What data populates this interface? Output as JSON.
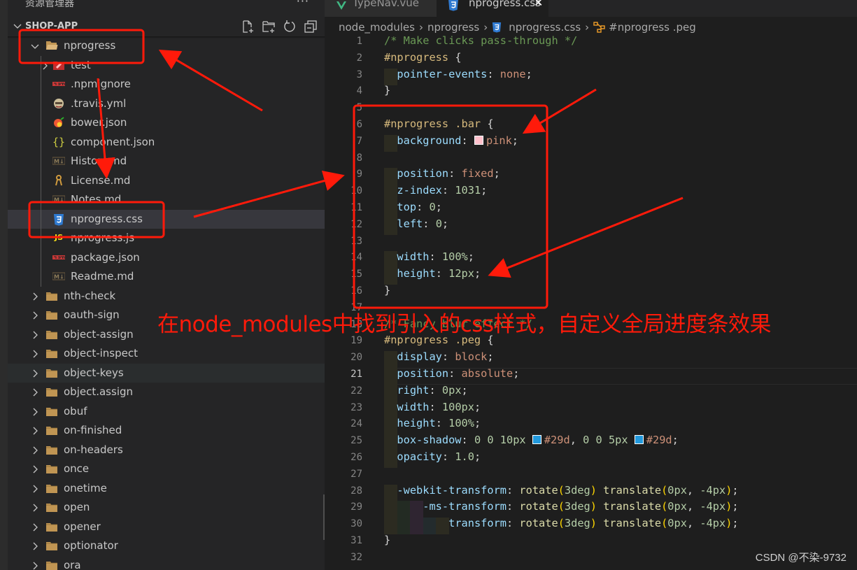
{
  "sidebar": {
    "title": "资源管理器",
    "more_label": "···",
    "section_name": "SHOP-APP",
    "actions": [
      "new-file",
      "new-folder",
      "refresh",
      "collapse-all"
    ],
    "tree": [
      {
        "label": "nprogress",
        "kind": "folder-open",
        "depth": 1,
        "expanded": true
      },
      {
        "label": "test",
        "kind": "test-folder",
        "depth": 2,
        "expanded": false
      },
      {
        "label": ".npmignore",
        "kind": "npm",
        "depth": 2
      },
      {
        "label": ".travis.yml",
        "kind": "travis",
        "depth": 2
      },
      {
        "label": "bower.json",
        "kind": "bower",
        "depth": 2
      },
      {
        "label": "component.json",
        "kind": "json",
        "depth": 2
      },
      {
        "label": "History.md",
        "kind": "markdown",
        "depth": 2
      },
      {
        "label": "License.md",
        "kind": "license",
        "depth": 2
      },
      {
        "label": "Notes.md",
        "kind": "markdown",
        "depth": 2
      },
      {
        "label": "nprogress.css",
        "kind": "css",
        "depth": 2,
        "selected": true
      },
      {
        "label": "nprogress.js",
        "kind": "js",
        "depth": 2
      },
      {
        "label": "package.json",
        "kind": "npm",
        "depth": 2
      },
      {
        "label": "Readme.md",
        "kind": "markdown",
        "depth": 2
      },
      {
        "label": "nth-check",
        "kind": "folder",
        "depth": 1
      },
      {
        "label": "oauth-sign",
        "kind": "folder",
        "depth": 1
      },
      {
        "label": "object-assign",
        "kind": "folder",
        "depth": 1
      },
      {
        "label": "object-inspect",
        "kind": "folder",
        "depth": 1
      },
      {
        "label": "object-keys",
        "kind": "folder",
        "depth": 1,
        "hover": true
      },
      {
        "label": "object.assign",
        "kind": "folder",
        "depth": 1
      },
      {
        "label": "obuf",
        "kind": "folder",
        "depth": 1
      },
      {
        "label": "on-finished",
        "kind": "folder",
        "depth": 1
      },
      {
        "label": "on-headers",
        "kind": "folder",
        "depth": 1
      },
      {
        "label": "once",
        "kind": "folder",
        "depth": 1
      },
      {
        "label": "onetime",
        "kind": "folder",
        "depth": 1
      },
      {
        "label": "open",
        "kind": "folder",
        "depth": 1
      },
      {
        "label": "opener",
        "kind": "folder",
        "depth": 1
      },
      {
        "label": "optionator",
        "kind": "folder",
        "depth": 1
      },
      {
        "label": "ora",
        "kind": "folder",
        "depth": 1
      }
    ]
  },
  "tabs": [
    {
      "label": "TypeNav.vue",
      "icon": "vue-icon",
      "active": false
    },
    {
      "label": "nprogress.css",
      "icon": "css-icon",
      "active": true,
      "close": "✕"
    }
  ],
  "breadcrumb": [
    "node_modules",
    "nprogress",
    "nprogress.css",
    "#nprogress .peg"
  ],
  "editor": {
    "active_line": 21,
    "lines": [
      [
        [
          "c-com",
          "/* Make clicks pass-through */"
        ]
      ],
      [
        [
          "c-sel",
          "#nprogress "
        ],
        [
          "",
          "{"
        ]
      ],
      [
        [
          "",
          "  "
        ],
        [
          "c-prop",
          "pointer-events"
        ],
        [
          "",
          ": "
        ],
        [
          "c-val",
          "none"
        ],
        [
          "",
          ";"
        ]
      ],
      [
        [
          "",
          "}"
        ]
      ],
      [],
      [
        [
          "c-sel",
          "#nprogress .bar "
        ],
        [
          "",
          "{"
        ]
      ],
      [
        [
          "",
          "  "
        ],
        [
          "c-prop",
          "background"
        ],
        [
          "",
          ": "
        ],
        [
          "swatch",
          "#ffc0cb"
        ],
        [
          "c-val",
          "pink"
        ],
        [
          "",
          ";"
        ]
      ],
      [],
      [
        [
          "",
          "  "
        ],
        [
          "c-prop",
          "position"
        ],
        [
          "",
          ": "
        ],
        [
          "c-val",
          "fixed"
        ],
        [
          "",
          ";"
        ]
      ],
      [
        [
          "",
          "  "
        ],
        [
          "c-prop",
          "z-index"
        ],
        [
          "",
          ": "
        ],
        [
          "c-num",
          "1031"
        ],
        [
          "",
          ";"
        ]
      ],
      [
        [
          "",
          "  "
        ],
        [
          "c-prop",
          "top"
        ],
        [
          "",
          ": "
        ],
        [
          "c-num",
          "0"
        ],
        [
          "",
          ";"
        ]
      ],
      [
        [
          "",
          "  "
        ],
        [
          "c-prop",
          "left"
        ],
        [
          "",
          ": "
        ],
        [
          "c-num",
          "0"
        ],
        [
          "",
          ";"
        ]
      ],
      [],
      [
        [
          "",
          "  "
        ],
        [
          "c-prop",
          "width"
        ],
        [
          "",
          ": "
        ],
        [
          "c-num",
          "100%"
        ],
        [
          "",
          ";"
        ]
      ],
      [
        [
          "",
          "  "
        ],
        [
          "c-prop",
          "height"
        ],
        [
          "",
          ": "
        ],
        [
          "c-num",
          "12px"
        ],
        [
          "",
          ";"
        ]
      ],
      [
        [
          "",
          "}"
        ]
      ],
      [],
      [
        [
          "c-com",
          "/* Fancy blur effect */"
        ]
      ],
      [
        [
          "c-sel",
          "#nprogress .peg "
        ],
        [
          "",
          "{"
        ]
      ],
      [
        [
          "",
          "  "
        ],
        [
          "c-prop",
          "display"
        ],
        [
          "",
          ": "
        ],
        [
          "c-val",
          "block"
        ],
        [
          "",
          ";"
        ]
      ],
      [
        [
          "",
          "  "
        ],
        [
          "c-prop",
          "position"
        ],
        [
          "",
          ": "
        ],
        [
          "c-val",
          "absolute"
        ],
        [
          "",
          ";"
        ]
      ],
      [
        [
          "",
          "  "
        ],
        [
          "c-prop",
          "right"
        ],
        [
          "",
          ": "
        ],
        [
          "c-num",
          "0px"
        ],
        [
          "",
          ";"
        ]
      ],
      [
        [
          "",
          "  "
        ],
        [
          "c-prop",
          "width"
        ],
        [
          "",
          ": "
        ],
        [
          "c-num",
          "100px"
        ],
        [
          "",
          ";"
        ]
      ],
      [
        [
          "",
          "  "
        ],
        [
          "c-prop",
          "height"
        ],
        [
          "",
          ": "
        ],
        [
          "c-num",
          "100%"
        ],
        [
          "",
          ";"
        ]
      ],
      [
        [
          "",
          "  "
        ],
        [
          "c-prop",
          "box-shadow"
        ],
        [
          "",
          ": "
        ],
        [
          "c-num",
          "0 0 10px "
        ],
        [
          "swatch",
          "#2299dd"
        ],
        [
          "c-val",
          "#29d"
        ],
        [
          "",
          ", "
        ],
        [
          "c-num",
          "0 0 5px "
        ],
        [
          "swatch",
          "#2299dd"
        ],
        [
          "c-val",
          "#29d"
        ],
        [
          "",
          ";"
        ]
      ],
      [
        [
          "",
          "  "
        ],
        [
          "c-prop",
          "opacity"
        ],
        [
          "",
          ": "
        ],
        [
          "c-num",
          "1.0"
        ],
        [
          "",
          ";"
        ]
      ],
      [],
      [
        [
          "",
          "  "
        ],
        [
          "c-prop",
          "-webkit-transform"
        ],
        [
          "",
          ": "
        ],
        [
          "c-fn",
          "rotate"
        ],
        [
          "c-brc",
          "("
        ],
        [
          "c-num",
          "3deg"
        ],
        [
          "c-brc",
          ")"
        ],
        [
          "",
          " "
        ],
        [
          "c-fn",
          "translate"
        ],
        [
          "c-brc",
          "("
        ],
        [
          "c-num",
          "0px"
        ],
        [
          "",
          ", "
        ],
        [
          "c-num",
          "-4px"
        ],
        [
          "c-brc",
          ")"
        ],
        [
          "",
          ";"
        ]
      ],
      [
        [
          "",
          "      "
        ],
        [
          "c-prop",
          "-ms-transform"
        ],
        [
          "",
          ": "
        ],
        [
          "c-fn",
          "rotate"
        ],
        [
          "c-brc",
          "("
        ],
        [
          "c-num",
          "3deg"
        ],
        [
          "c-brc",
          ")"
        ],
        [
          "",
          " "
        ],
        [
          "c-fn",
          "translate"
        ],
        [
          "c-brc",
          "("
        ],
        [
          "c-num",
          "0px"
        ],
        [
          "",
          ", "
        ],
        [
          "c-num",
          "-4px"
        ],
        [
          "c-brc",
          ")"
        ],
        [
          "",
          ";"
        ]
      ],
      [
        [
          "",
          "          "
        ],
        [
          "c-prop",
          "transform"
        ],
        [
          "",
          ": "
        ],
        [
          "c-fn",
          "rotate"
        ],
        [
          "c-brc",
          "("
        ],
        [
          "c-num",
          "3deg"
        ],
        [
          "c-brc",
          ")"
        ],
        [
          "",
          " "
        ],
        [
          "c-fn",
          "translate"
        ],
        [
          "c-brc",
          "("
        ],
        [
          "c-num",
          "0px"
        ],
        [
          "",
          ", "
        ],
        [
          "c-num",
          "-4px"
        ],
        [
          "c-brc",
          ")"
        ],
        [
          "",
          ";"
        ]
      ],
      [
        [
          "",
          "}"
        ]
      ],
      []
    ]
  },
  "annotation": {
    "note": "在node_modules中找到引入的css样式，自定义全局进度条效果",
    "color": "#ff1a0a"
  },
  "watermark": "CSDN @不染-9732"
}
